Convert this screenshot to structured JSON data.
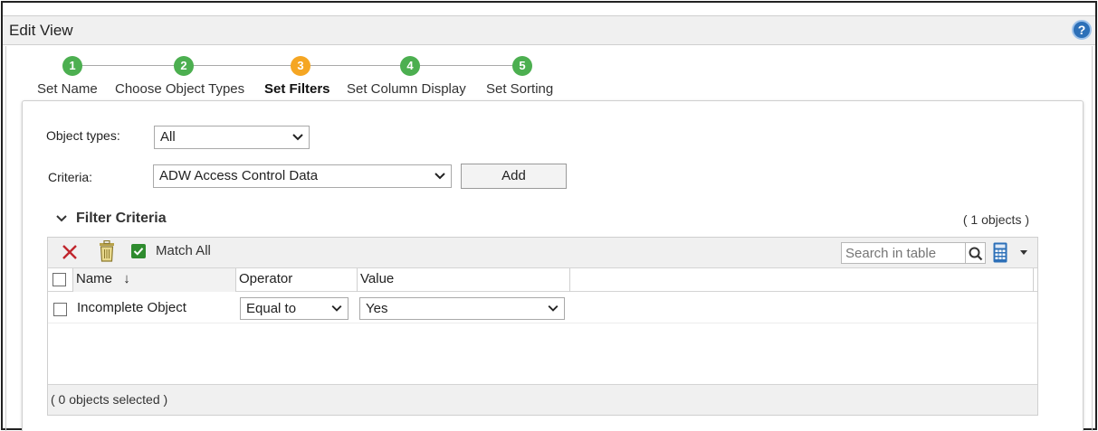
{
  "window": {
    "title": "Edit View"
  },
  "wizard": {
    "steps": [
      {
        "number": "1",
        "label": "Set Name",
        "state": "done"
      },
      {
        "number": "2",
        "label": "Choose Object Types",
        "state": "done"
      },
      {
        "number": "3",
        "label": "Set Filters",
        "state": "active"
      },
      {
        "number": "4",
        "label": "Set Column Display",
        "state": "done"
      },
      {
        "number": "5",
        "label": "Set Sorting",
        "state": "done"
      }
    ],
    "colors": {
      "done": "#4caf50",
      "active": "#f5a623"
    }
  },
  "form": {
    "object_types_label": "Object types:",
    "object_types_value": "All",
    "criteria_label": "Criteria:",
    "criteria_value": "ADW Access Control Data",
    "add_label": "Add"
  },
  "filter_section": {
    "title": "Filter Criteria",
    "count": "( 1 objects )",
    "toolbar": {
      "match_all_label": "Match All",
      "search_placeholder": "Search in table"
    },
    "columns": [
      "Name",
      "Operator",
      "Value"
    ],
    "sort_indicator": "↓",
    "rows": [
      {
        "name": "Incomplete Object",
        "operator": "Equal to",
        "value": "Yes"
      }
    ],
    "footer": "( 0 objects selected )"
  }
}
